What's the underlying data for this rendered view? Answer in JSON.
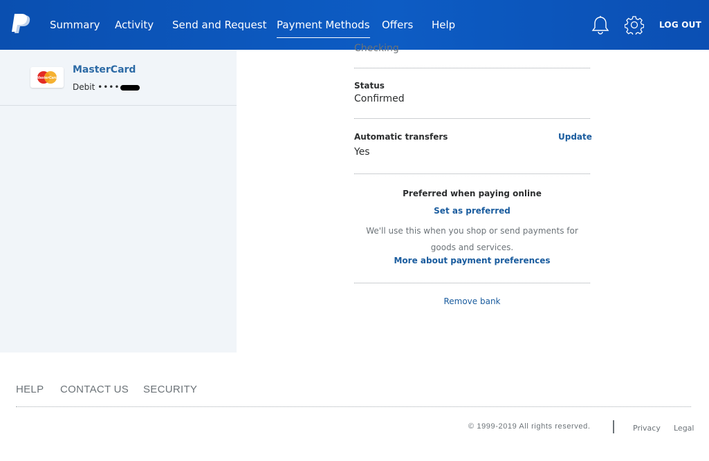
{
  "nav": {
    "items": [
      "Summary",
      "Activity",
      "Send and Request",
      "Payment Methods",
      "Offers",
      "Help"
    ],
    "logout": "LOG OUT"
  },
  "sidebar": {
    "card_name": "MasterCard",
    "card_logo_text": "MasterCard",
    "card_type": "Debit",
    "card_dots": "••••"
  },
  "detail": {
    "account_type_value": "Checking",
    "status_label": "Status",
    "status_value": "Confirmed",
    "auto_label": "Automatic transfers",
    "auto_value": "Yes",
    "update_link": "Update",
    "preferred_heading": "Preferred when paying online",
    "set_preferred_link": "Set as preferred",
    "preferred_desc": "We'll use this when you shop or send payments for goods and services.",
    "more_link": "More about payment preferences",
    "remove_link": "Remove bank"
  },
  "footer": {
    "links": [
      "HELP",
      "CONTACT US",
      "SECURITY"
    ],
    "copyright": "© 1999-2019 All rights reserved.",
    "privacy": "Privacy",
    "legal": "Legal"
  },
  "colors": {
    "header": "#0d5cc4",
    "link": "#1a5c9e",
    "panel": "#f1f5f9"
  }
}
